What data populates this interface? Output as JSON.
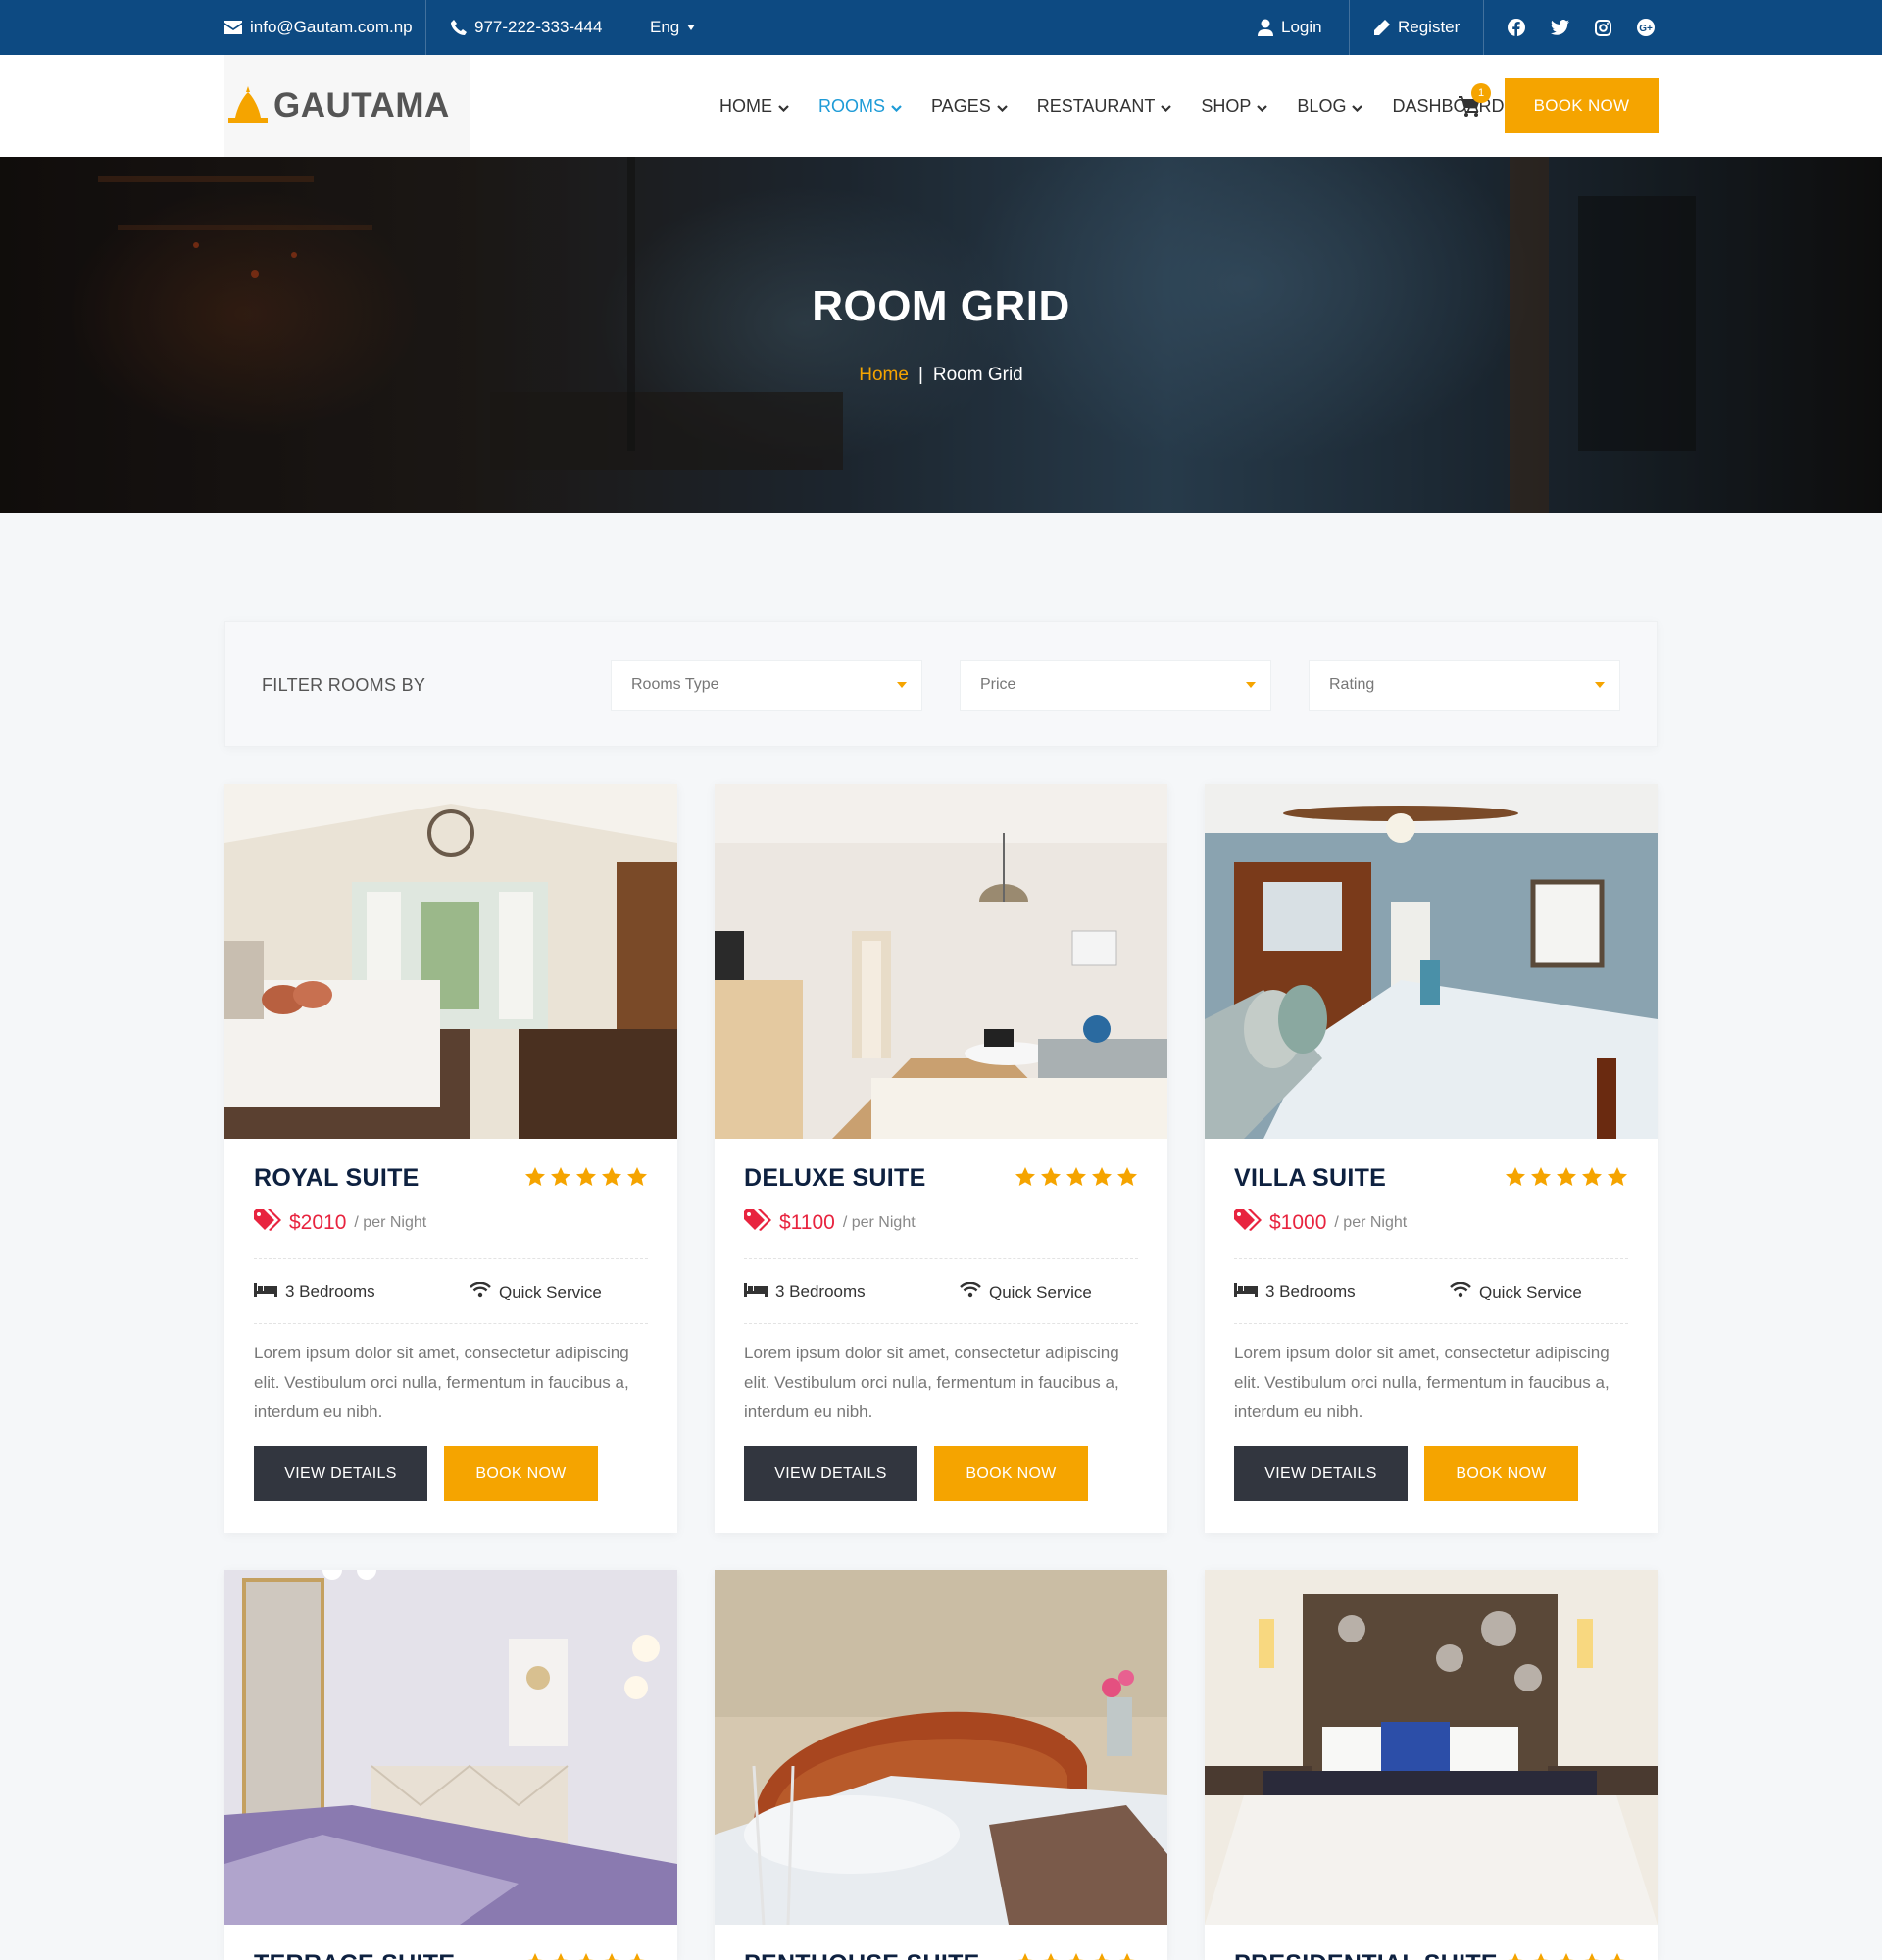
{
  "topbar": {
    "email": "info@Gautam.com.np",
    "phone": "977-222-333-444",
    "language": "Eng",
    "login": "Login",
    "register": "Register",
    "social_icons": [
      "facebook-icon",
      "twitter-icon",
      "instagram-icon",
      "google-plus-icon"
    ]
  },
  "header": {
    "logo": "GAUTAMA",
    "nav": [
      {
        "label": "HOME",
        "active": false
      },
      {
        "label": "ROOMS",
        "active": true
      },
      {
        "label": "PAGES",
        "active": false
      },
      {
        "label": "RESTAURANT",
        "active": false
      },
      {
        "label": "SHOP",
        "active": false
      },
      {
        "label": "BLOG",
        "active": false
      },
      {
        "label": "DASHBOARD",
        "active": false
      }
    ],
    "cart_count": "1",
    "book_now": "BOOK NOW"
  },
  "hero": {
    "title": "ROOM GRID",
    "breadcrumb_home": "Home",
    "breadcrumb_sep": "|",
    "breadcrumb_current": "Room Grid"
  },
  "filter": {
    "label": "FILTER ROOMS BY",
    "selects": [
      "Rooms Type",
      "Price",
      "Rating"
    ]
  },
  "rooms": [
    {
      "name": "ROYAL SUITE",
      "rating": 5,
      "price": "$2010",
      "per": "/ per Night",
      "bedrooms": "3 Bedrooms",
      "service": "Quick Service",
      "description": "Lorem ipsum dolor sit amet, consectetur adipiscing elit. Vestibulum orci nulla, fermentum in faucibus a, interdum eu nibh.",
      "view_details": "VIEW DETAILS",
      "book_now": "BOOK NOW"
    },
    {
      "name": "DELUXE SUITE",
      "rating": 5,
      "price": "$1100",
      "per": "/ per Night",
      "bedrooms": "3 Bedrooms",
      "service": "Quick Service",
      "description": "Lorem ipsum dolor sit amet, consectetur adipiscing elit. Vestibulum orci nulla, fermentum in faucibus a, interdum eu nibh.",
      "view_details": "VIEW DETAILS",
      "book_now": "BOOK NOW"
    },
    {
      "name": "VILLA SUITE",
      "rating": 5,
      "price": "$1000",
      "per": "/ per Night",
      "bedrooms": "3 Bedrooms",
      "service": "Quick Service",
      "description": "Lorem ipsum dolor sit amet, consectetur adipiscing elit. Vestibulum orci nulla, fermentum in faucibus a, interdum eu nibh.",
      "view_details": "VIEW DETAILS",
      "book_now": "BOOK NOW"
    },
    {
      "name": "TERRACE SUITE",
      "rating": 5
    },
    {
      "name": "PENTHOUSE SUITE",
      "rating": 5
    },
    {
      "name": "PRESIDENTIAL SUITE",
      "rating": 5
    }
  ],
  "colors": {
    "topbar": "#0d4a82",
    "accent": "#f5a400",
    "active_nav": "#1e9bd7",
    "price": "#e8243f",
    "dark_button": "#32363f",
    "room_title": "#0e2140"
  }
}
